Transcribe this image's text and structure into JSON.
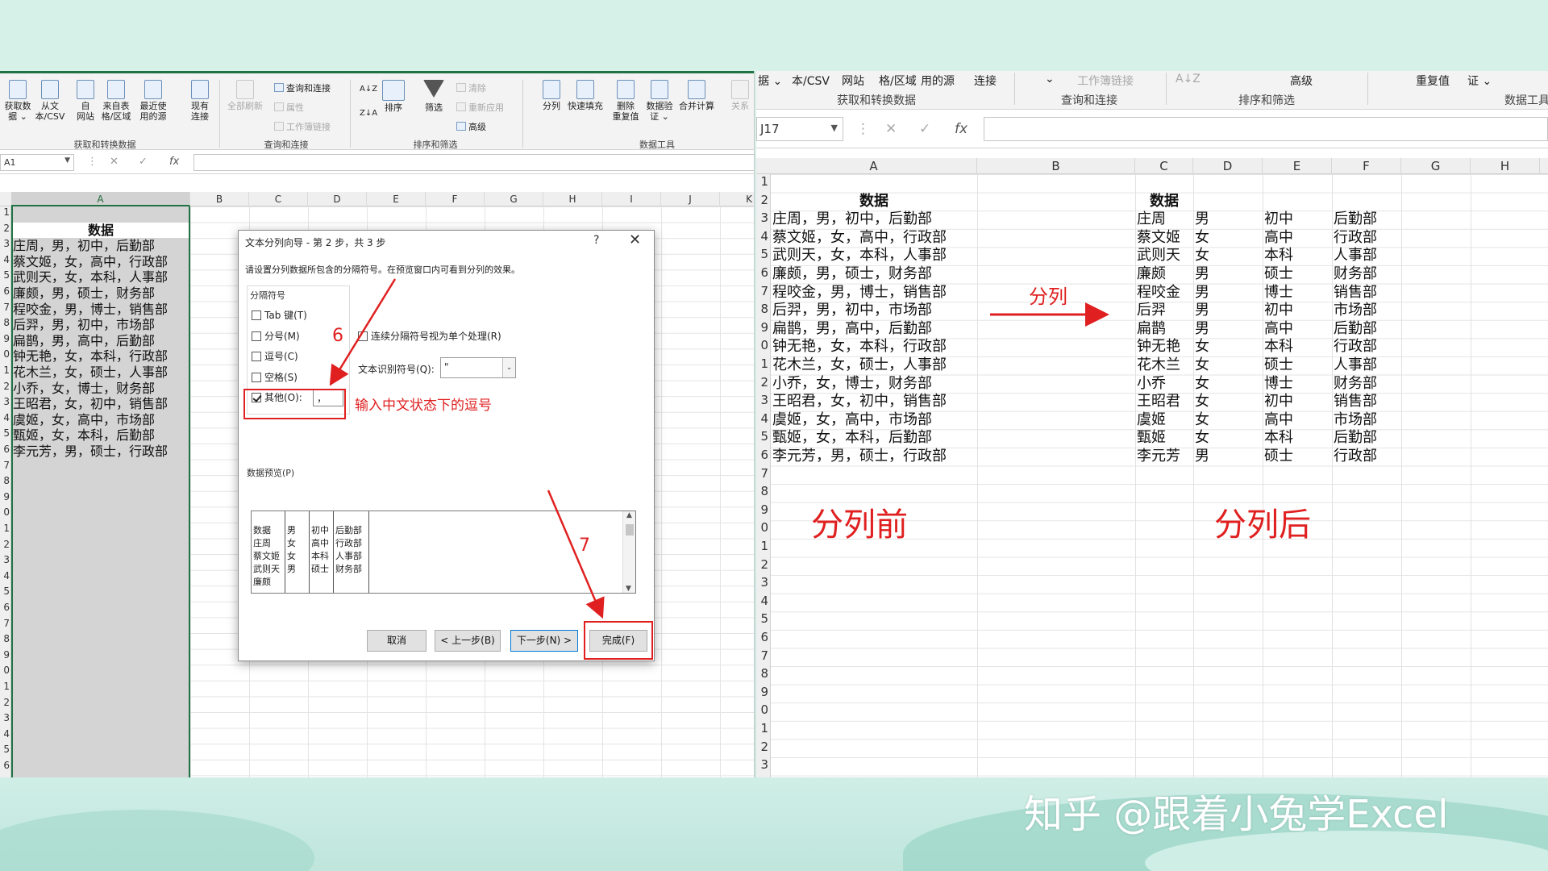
{
  "left": {
    "ribbon": {
      "get_data": [
        {
          "label": "获取数\n据 ⌄",
          "icon": "get-data-icon"
        },
        {
          "label": "从文\n本/CSV",
          "icon": "text-csv-icon"
        },
        {
          "label": "自\n网站",
          "icon": "web-icon"
        },
        {
          "label": "来自表\n格/区域",
          "icon": "table-range-icon"
        },
        {
          "label": "最近使\n用的源",
          "icon": "recent-sources-icon"
        },
        {
          "label": "现有\n连接",
          "icon": "existing-connections-icon"
        }
      ],
      "get_data_group": "获取和转换数据",
      "refresh_all": "全部刷新",
      "query_items": [
        "查询和连接",
        "属性",
        "工作簿链接"
      ],
      "query_group": "查询和连接",
      "sort_az": "A↓Z",
      "sort_za": "Z↓A",
      "sort": "排序",
      "filter": "筛选",
      "filter_items": [
        "清除",
        "重新应用",
        "高级"
      ],
      "sort_group": "排序和筛选",
      "tools": [
        "分列",
        "快速填充",
        "删除\n重复值",
        "数据验\n证 ⌄",
        "合并计算",
        "关系"
      ],
      "tools_group": "数据工具"
    },
    "name_box": "A1",
    "columns": [
      "A",
      "B",
      "C",
      "D",
      "E",
      "F",
      "G",
      "H",
      "I",
      "J",
      "K"
    ],
    "row_numbers": [
      "1",
      "2",
      "3",
      "4",
      "5",
      "6",
      "7",
      "8",
      "9",
      "0",
      "1",
      "2",
      "3",
      "4",
      "5",
      "6",
      "7",
      "8",
      "9",
      "0",
      "1",
      "2",
      "3",
      "4",
      "5",
      "6",
      "7",
      "8",
      "9",
      "0",
      "1",
      "2",
      "3",
      "4",
      "5",
      "6"
    ],
    "header": "数据",
    "rows": [
      "庄周，男，初中，后勤部",
      "蔡文姬，女，高中，行政部",
      "武则天，女，本科，人事部",
      "廉颇，男，硕士，财务部",
      "程咬金，男，博士，销售部",
      "后羿，男，初中，市场部",
      "扁鹊，男，高中，后勤部",
      "钟无艳，女，本科，行政部",
      "花木兰，女，硕士，人事部",
      "小乔，女，博士，财务部",
      "王昭君，女，初中，销售部",
      "虞姬，女，高中，市场部",
      "甄姬，女，本科，后勤部",
      "李元芳，男，硕士，行政部"
    ]
  },
  "dialog": {
    "title": "文本分列向导 - 第 2 步，共 3 步",
    "help": "?",
    "close": "✕",
    "description": "请设置分列数据所包含的分隔符号。在预览窗口内可看到分列的效果。",
    "delimiters_title": "分隔符号",
    "checkboxes": [
      {
        "label": "Tab 键(T)",
        "checked": false
      },
      {
        "label": "分号(M)",
        "checked": false
      },
      {
        "label": "逗号(C)",
        "checked": false
      },
      {
        "label": "空格(S)",
        "checked": false
      },
      {
        "label": "其他(O):",
        "checked": true
      }
    ],
    "other_value": "，",
    "consecutive": "连续分隔符号视为单个处理(R)",
    "qualifier_label": "文本识别符号(Q):",
    "qualifier_value": "\"",
    "preview_label": "数据预览(P)",
    "preview_columns": [
      [
        "数据",
        "庄周",
        "蔡文姬",
        "武则天",
        "廉颇"
      ],
      [
        "",
        "男",
        "女",
        "女",
        "男"
      ],
      [
        "",
        "初中",
        "高中",
        "本科",
        "硕士"
      ],
      [
        "",
        "后勤部",
        "行政部",
        "人事部",
        "财务部"
      ]
    ],
    "buttons": {
      "cancel": "取消",
      "back": "< 上一步(B)",
      "next": "下一步(N) >",
      "finish": "完成(F)"
    }
  },
  "annotations": {
    "step6": "6",
    "step7": "7",
    "comma_note": "输入中文状态下的逗号",
    "split_arrow": "分列",
    "before": "分列前",
    "after": "分列后"
  },
  "right": {
    "ribbon_items": [
      "据 ⌄",
      "本/CSV",
      "网站",
      "格/区域",
      "用的源",
      "连接",
      "⌄",
      "工作簿链接",
      "A↓Z",
      "高级",
      "重复值",
      "证 ⌄"
    ],
    "ribbon_groups": [
      "获取和转换数据",
      "查询和连接",
      "排序和筛选",
      "数据工具"
    ],
    "name_box": "J17",
    "columns": [
      "A",
      "B",
      "C",
      "D",
      "E",
      "F",
      "G",
      "H"
    ],
    "row_numbers": [
      "1",
      "2",
      "3",
      "4",
      "5",
      "6",
      "7",
      "8",
      "9",
      "0",
      "1",
      "2",
      "3",
      "4",
      "5",
      "6",
      "7",
      "8",
      "9",
      "0",
      "1",
      "2",
      "3",
      "4",
      "5",
      "6",
      "7",
      "8",
      "9",
      "0",
      "1",
      "2",
      "3"
    ],
    "header_a": "数据",
    "header_c": "数据",
    "rows_a": [
      "庄周，男，初中，后勤部",
      "蔡文姬，女，高中，行政部",
      "武则天，女，本科，人事部",
      "廉颇，男，硕士，财务部",
      "程咬金，男，博士，销售部",
      "后羿，男，初中，市场部",
      "扁鹊，男，高中，后勤部",
      "钟无艳，女，本科，行政部",
      "花木兰，女，硕士，人事部",
      "小乔，女，博士，财务部",
      "王昭君，女，初中，销售部",
      "虞姬，女，高中，市场部",
      "甄姬，女，本科，后勤部",
      "李元芳，男，硕士，行政部"
    ],
    "split_rows": [
      [
        "庄周",
        "男",
        "初中",
        "后勤部"
      ],
      [
        "蔡文姬",
        "女",
        "高中",
        "行政部"
      ],
      [
        "武则天",
        "女",
        "本科",
        "人事部"
      ],
      [
        "廉颇",
        "男",
        "硕士",
        "财务部"
      ],
      [
        "程咬金",
        "男",
        "博士",
        "销售部"
      ],
      [
        "后羿",
        "男",
        "初中",
        "市场部"
      ],
      [
        "扁鹊",
        "男",
        "高中",
        "后勤部"
      ],
      [
        "钟无艳",
        "女",
        "本科",
        "行政部"
      ],
      [
        "花木兰",
        "女",
        "硕士",
        "人事部"
      ],
      [
        "小乔",
        "女",
        "博士",
        "财务部"
      ],
      [
        "王昭君",
        "女",
        "初中",
        "销售部"
      ],
      [
        "虞姬",
        "女",
        "高中",
        "市场部"
      ],
      [
        "甄姬",
        "女",
        "本科",
        "后勤部"
      ],
      [
        "李元芳",
        "男",
        "硕士",
        "行政部"
      ]
    ]
  },
  "watermark": "知乎 @跟着小兔学Excel",
  "colors": {
    "accent_red": "#e02020",
    "excel_green": "#217346",
    "background": "#d6f1e8"
  }
}
